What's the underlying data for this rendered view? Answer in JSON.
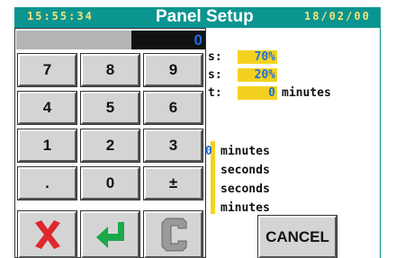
{
  "header": {
    "time": "15:55:34",
    "title": "Panel Setup",
    "date": "18/02/00"
  },
  "background_form": {
    "rows": [
      {
        "label_fragment": "s:",
        "value": "70%"
      },
      {
        "label_fragment": "s:",
        "value": "20%"
      },
      {
        "label_fragment": "t:",
        "value": "0",
        "unit": "minutes"
      }
    ],
    "units_list": [
      "minutes",
      "seconds",
      "seconds",
      "minutes"
    ],
    "partial_value": "0"
  },
  "keypad": {
    "display_value": "0",
    "keys": [
      "7",
      "8",
      "9",
      "4",
      "5",
      "6",
      "1",
      "2",
      "3",
      ".",
      "0",
      "±"
    ],
    "action_icons": [
      "delete-x-icon",
      "enter-arrow-icon",
      "clear-c-icon"
    ]
  },
  "cancel_button": {
    "label": "CANCEL"
  },
  "colors": {
    "header_bg": "#0b9590",
    "header_time_text": "#f3e37a",
    "value_box": "#f3d21f",
    "value_text": "#1f6fe0",
    "delete_red": "#e0272e",
    "enter_green": "#1aa84a",
    "clear_gray": "#9a9a9a"
  }
}
